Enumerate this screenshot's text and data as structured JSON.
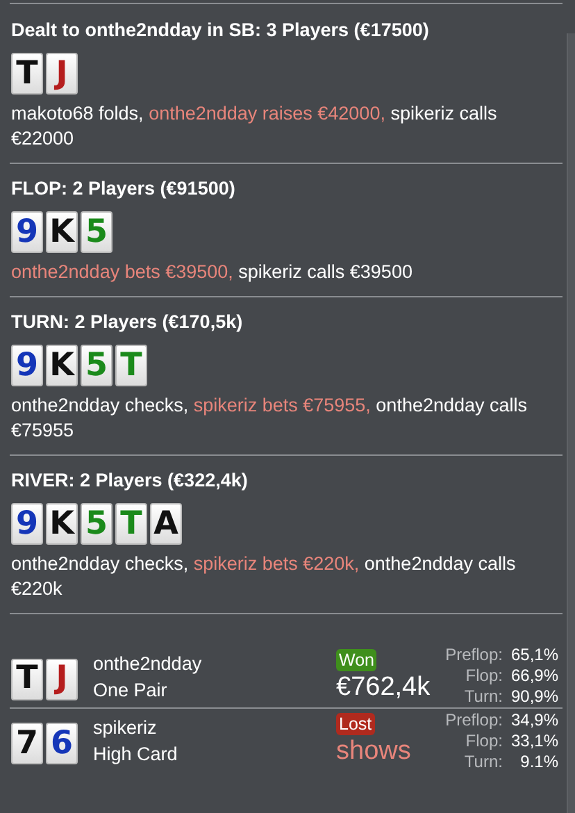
{
  "streets": [
    {
      "title": "Dealt to onthe2ndday in SB: 3 Players (€17500)",
      "cards": [
        {
          "rank": "T",
          "color": "#111111"
        },
        {
          "rank": "J",
          "color": "#b51d1d"
        }
      ],
      "actions": [
        {
          "text": "makoto68 folds, ",
          "hero": false
        },
        {
          "text": "onthe2ndday raises €42000,",
          "hero": true
        },
        {
          "text": " spikeriz calls €22000",
          "hero": false
        }
      ]
    },
    {
      "title": "FLOP: 2 Players (€91500)",
      "cards": [
        {
          "rank": "9",
          "color": "#1536b8"
        },
        {
          "rank": "K",
          "color": "#111111"
        },
        {
          "rank": "5",
          "color": "#1b8a1b"
        }
      ],
      "actions": [
        {
          "text": "onthe2ndday bets €39500,",
          "hero": true
        },
        {
          "text": " spikeriz calls €39500",
          "hero": false
        }
      ]
    },
    {
      "title": "TURN: 2 Players (€170,5k)",
      "cards": [
        {
          "rank": "9",
          "color": "#1536b8"
        },
        {
          "rank": "K",
          "color": "#111111"
        },
        {
          "rank": "5",
          "color": "#1b8a1b"
        },
        {
          "rank": "T",
          "color": "#1b8a1b"
        }
      ],
      "actions": [
        {
          "text": "onthe2ndday checks, ",
          "hero": false
        },
        {
          "text": "spikeriz bets €75955,",
          "hero": true
        },
        {
          "text": " onthe2ndday calls €75955",
          "hero": false
        }
      ]
    },
    {
      "title": "RIVER: 2 Players (€322,4k)",
      "cards": [
        {
          "rank": "9",
          "color": "#1536b8"
        },
        {
          "rank": "K",
          "color": "#111111"
        },
        {
          "rank": "5",
          "color": "#1b8a1b"
        },
        {
          "rank": "T",
          "color": "#1b8a1b"
        },
        {
          "rank": "A",
          "color": "#111111"
        }
      ],
      "actions": [
        {
          "text": "onthe2ndday checks, ",
          "hero": false
        },
        {
          "text": "spikeriz bets €220k,",
          "hero": true
        },
        {
          "text": " onthe2ndday calls €220k",
          "hero": false
        }
      ]
    }
  ],
  "results": [
    {
      "cards": [
        {
          "rank": "T",
          "color": "#111111"
        },
        {
          "rank": "J",
          "color": "#b51d1d"
        }
      ],
      "player": "onthe2ndday",
      "hand": "One Pair",
      "outcome": {
        "kind": "won",
        "label": "Won"
      },
      "amount": "€762,4k",
      "equity": [
        {
          "street": "Preflop:",
          "value": "65,1%"
        },
        {
          "street": "Flop:",
          "value": "66,9%"
        },
        {
          "street": "Turn:",
          "value": "90,9%"
        }
      ]
    },
    {
      "cards": [
        {
          "rank": "7",
          "color": "#111111"
        },
        {
          "rank": "6",
          "color": "#1536b8"
        }
      ],
      "player": "spikeriz",
      "hand": "High Card",
      "outcome": {
        "kind": "lost",
        "label": "Lost"
      },
      "amount": "shows",
      "equity": [
        {
          "street": "Preflop:",
          "value": "34,9%"
        },
        {
          "street": "Flop:",
          "value": "33,1%"
        },
        {
          "street": "Turn:",
          "value": "9.1%"
        }
      ]
    }
  ]
}
